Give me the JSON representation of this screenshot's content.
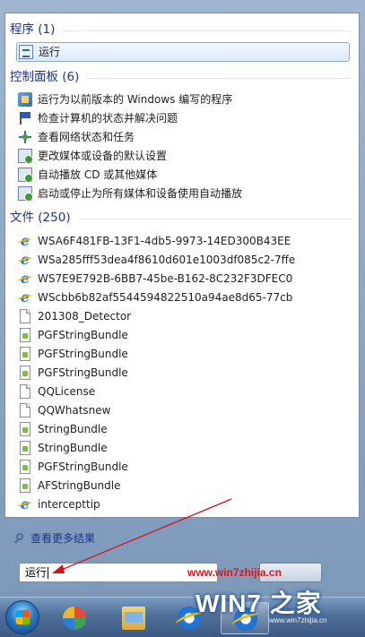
{
  "groups": {
    "programs": {
      "header": "程序 (1)",
      "items": [
        {
          "label": "运行",
          "icon": "run-icon"
        }
      ]
    },
    "control_panel": {
      "header": "控制面板 (6)",
      "items": [
        {
          "label": "运行为以前版本的 Windows 编写的程序",
          "icon": "compatibility-icon"
        },
        {
          "label": "检查计算机的状态并解决问题",
          "icon": "action-center-flag-icon"
        },
        {
          "label": "查看网络状态和任务",
          "icon": "network-icon"
        },
        {
          "label": "更改媒体或设备的默认设置",
          "icon": "autoplay-icon"
        },
        {
          "label": "自动播放 CD 或其他媒体",
          "icon": "autoplay-icon"
        },
        {
          "label": "启动或停止为所有媒体和设备使用自动播放",
          "icon": "autoplay-icon"
        }
      ]
    },
    "files": {
      "header": "文件 (250)",
      "items": [
        {
          "label": "WSA6F481FB-13F1-4db5-9973-14ED300B43EE",
          "icon": "ie-icon"
        },
        {
          "label": "WSa285fff53dea4f8610d601e1003df085c2-7ffe",
          "icon": "ie-icon"
        },
        {
          "label": "WS7E9E792B-6BB7-45be-B162-8C232F3DFEC0",
          "icon": "ie-icon"
        },
        {
          "label": "WScbb6b82af5544594822510a94ae8d65-77cb",
          "icon": "ie-icon"
        },
        {
          "label": "201308_Detector",
          "icon": "document-icon"
        },
        {
          "label": "PGFStringBundle",
          "icon": "bundle-icon"
        },
        {
          "label": "PGFStringBundle",
          "icon": "bundle-icon"
        },
        {
          "label": "PGFStringBundle",
          "icon": "bundle-icon"
        },
        {
          "label": "QQLicense",
          "icon": "document-icon"
        },
        {
          "label": "QQWhatsnew",
          "icon": "document-icon"
        },
        {
          "label": "StringBundle",
          "icon": "bundle-icon"
        },
        {
          "label": "StringBundle",
          "icon": "bundle-icon"
        },
        {
          "label": "PGFStringBundle",
          "icon": "bundle-icon"
        },
        {
          "label": "AFStringBundle",
          "icon": "bundle-icon"
        },
        {
          "label": "intercepttip",
          "icon": "ie-icon"
        }
      ]
    }
  },
  "search_more": "查看更多结果",
  "search": {
    "value": "运行"
  },
  "watermark": {
    "url": "www.win7zhijia.cn",
    "logo": "WIN7 之家",
    "site": "www.win7zhijia.cn"
  },
  "colors": {
    "header": "#1e3287",
    "arrow": "#d4151c",
    "selection_border": "#84acdd"
  }
}
